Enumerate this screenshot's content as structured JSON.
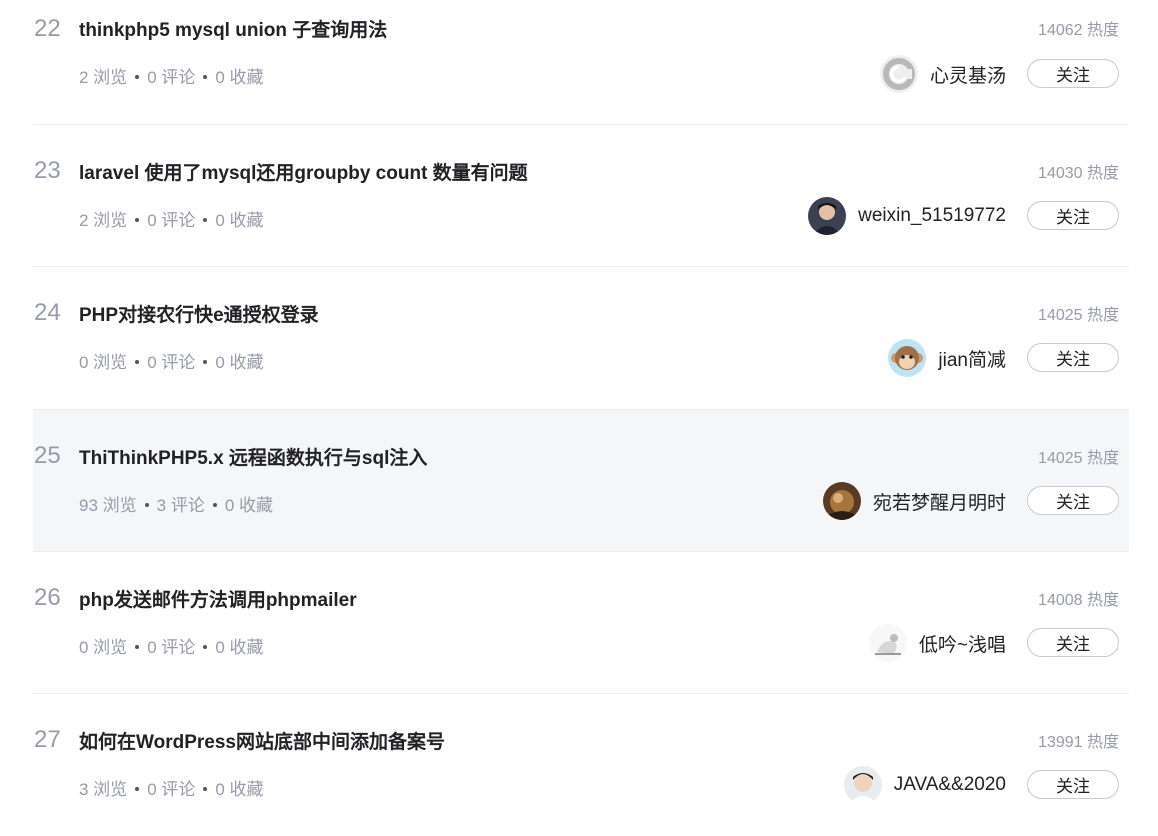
{
  "articles": [
    {
      "rank": "22",
      "title": "thinkphp5 mysql union 子查询用法",
      "hot": "14062 热度",
      "views": "2 浏览",
      "comments": "0 评论",
      "favorites": "0 收藏",
      "author": "心灵基汤",
      "follow": "关注"
    },
    {
      "rank": "23",
      "title": "laravel 使用了mysql还用groupby count 数量有问题",
      "hot": "14030 热度",
      "views": "2 浏览",
      "comments": "0 评论",
      "favorites": "0 收藏",
      "author": "weixin_51519772",
      "follow": "关注"
    },
    {
      "rank": "24",
      "title": "PHP对接农行快e通授权登录",
      "hot": "14025 热度",
      "views": "0 浏览",
      "comments": "0 评论",
      "favorites": "0 收藏",
      "author": "jian简减",
      "follow": "关注"
    },
    {
      "rank": "25",
      "title": "ThiThinkPHP5.x 远程函数执行与sql注入",
      "hot": "14025 热度",
      "views": "93 浏览",
      "comments": "3 评论",
      "favorites": "0 收藏",
      "author": "宛若梦醒月明时",
      "follow": "关注"
    },
    {
      "rank": "26",
      "title": "php发送邮件方法调用phpmailer",
      "hot": "14008 热度",
      "views": "0 浏览",
      "comments": "0 评论",
      "favorites": "0 收藏",
      "author": "低吟~浅唱",
      "follow": "关注"
    },
    {
      "rank": "27",
      "title": "如何在WordPress网站底部中间添加备案号",
      "hot": "13991 热度",
      "views": "3 浏览",
      "comments": "0 评论",
      "favorites": "0 收藏",
      "author": "JAVA&&2020",
      "follow": "关注"
    }
  ]
}
